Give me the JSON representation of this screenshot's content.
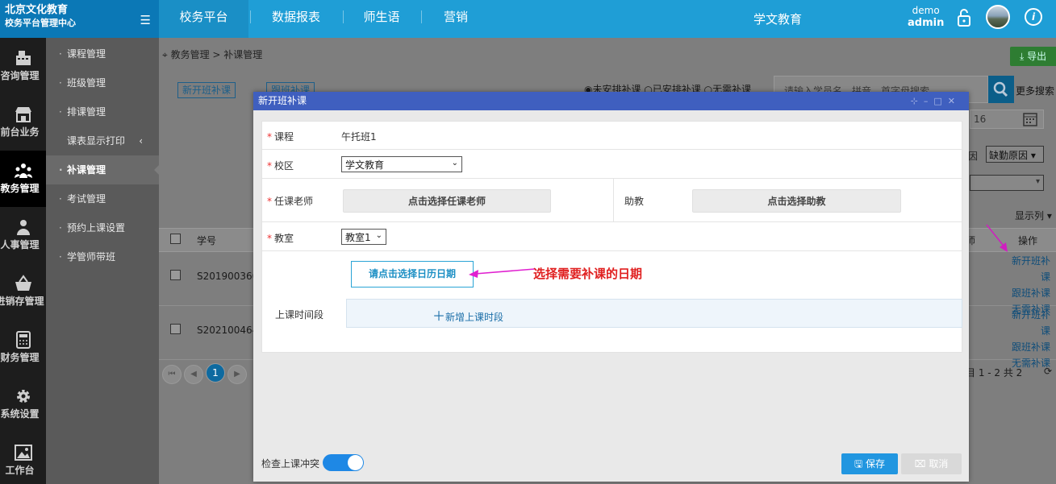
{
  "brand": {
    "line1": "北京文化教育",
    "line2": "校务平台管理中心"
  },
  "topnav": [
    {
      "label": "校务平台",
      "active": true
    },
    {
      "label": "数据报表",
      "active": false
    },
    {
      "label": "师生语",
      "active": false
    },
    {
      "label": "营销",
      "active": false
    }
  ],
  "org_name": "学文教育",
  "user": {
    "name": "demo",
    "role": "admin"
  },
  "iconbar": [
    {
      "label": "咨询管理",
      "icon": "register-icon"
    },
    {
      "label": "前台业务",
      "icon": "shop-icon"
    },
    {
      "label": "教务管理",
      "icon": "people-icon",
      "active": true
    },
    {
      "label": "人事管理",
      "icon": "person-icon"
    },
    {
      "label": "进销存管理",
      "icon": "basket-icon"
    },
    {
      "label": "财务管理",
      "icon": "calculator-icon"
    },
    {
      "label": "系统设置",
      "icon": "gear-icon"
    },
    {
      "label": "工作台",
      "icon": "picture-icon"
    }
  ],
  "submenu": [
    {
      "label": "课程管理"
    },
    {
      "label": "班级管理"
    },
    {
      "label": "排课管理"
    },
    {
      "label": "课表显示打印"
    },
    {
      "label": "补课管理",
      "active": true
    },
    {
      "label": "考试管理"
    },
    {
      "label": "预约上课设置"
    },
    {
      "label": "学管师带班"
    }
  ],
  "breadcrumb": "教务管理 > 补课管理",
  "export_label": "导出",
  "tabs": {
    "new_class": "新开班补课",
    "follow_class": "跟班补课"
  },
  "radios": {
    "unscheduled": "未安排补课",
    "scheduled": "已安排补课",
    "no_need": "无需补课"
  },
  "search": {
    "placeholder": "请输入学员名、拼音、首字母搜索",
    "more": "更多搜索"
  },
  "date_value": "16",
  "filters": {
    "reason_label": "因",
    "reason_select": "缺勤原因"
  },
  "show_columns": "显示列",
  "table": {
    "headers": {
      "student_no": "学号",
      "teacher": "师",
      "op": "操作"
    },
    "rows": [
      {
        "student_no": "S201900360",
        "ops": [
          "新开班补课",
          "跟班补课",
          "无需补课"
        ]
      },
      {
        "student_no": "S202100464",
        "ops": [
          "新开班补课",
          "跟班补课",
          "无需补课"
        ]
      }
    ]
  },
  "pager": {
    "current": "1",
    "info": "目 1 - 2 共 2"
  },
  "dialog": {
    "title": "新开班补课",
    "course_label": "课程",
    "course_value": "午托班1",
    "campus_label": "校区",
    "campus_value": "学文教育",
    "teacher_label": "任课老师",
    "teacher_button": "点击选择任课老师",
    "assistant_label": "助教",
    "assistant_button": "点击选择助教",
    "classroom_label": "教室",
    "classroom_value": "教室1",
    "date_button": "请点击选择日历日期",
    "annotation": "选择需要补课的日期",
    "timeslot_label": "上课时间段",
    "add_timeslot": "新增上课时段",
    "conflict_label": "检查上课冲突",
    "save": "保存",
    "cancel": "取消"
  },
  "colors": {
    "topbar": "#1f9ed6",
    "dialog_title": "#3f5fbf",
    "accent": "#2196e0",
    "annotation": "#e02020",
    "arrow": "#e020d0"
  }
}
